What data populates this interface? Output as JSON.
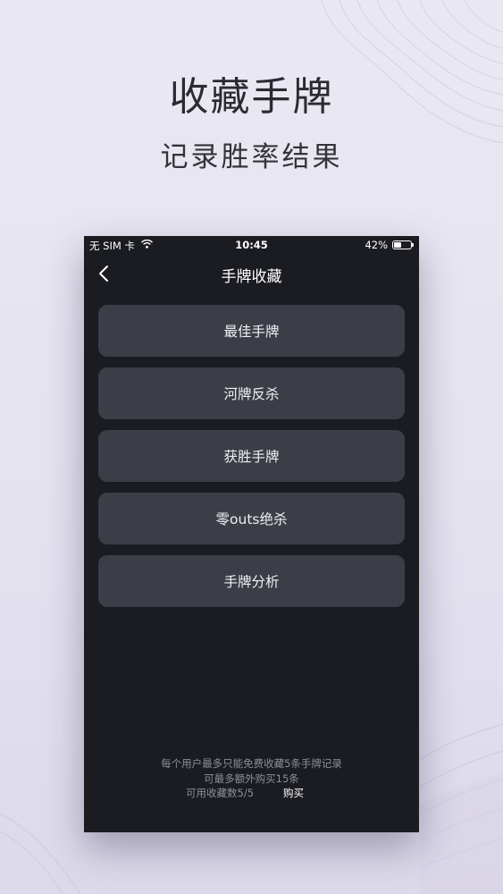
{
  "hero": {
    "title": "收藏手牌",
    "subtitle": "记录胜率结果"
  },
  "status_bar": {
    "carrier": "无 SIM 卡",
    "time": "10:45",
    "battery_percent": "42%",
    "battery_level": 0.42
  },
  "nav": {
    "back_icon": "chevron-left-icon",
    "title": "手牌收藏"
  },
  "menu": {
    "items": [
      {
        "label": "最佳手牌"
      },
      {
        "label": "河牌反杀"
      },
      {
        "label": "获胜手牌"
      },
      {
        "label": "零outs绝杀"
      },
      {
        "label": "手牌分析"
      }
    ]
  },
  "footer": {
    "note_line1": "每个用户最多只能免费收藏5条手牌记录",
    "note_line2": "可最多额外购买15条",
    "quota": "可用收藏数5/5",
    "buy_label": "购买"
  },
  "colors": {
    "background": "#e6e4f0",
    "screen": "#1b1c22",
    "button": "#3b3d47",
    "footer_text": "#8d8e96"
  }
}
